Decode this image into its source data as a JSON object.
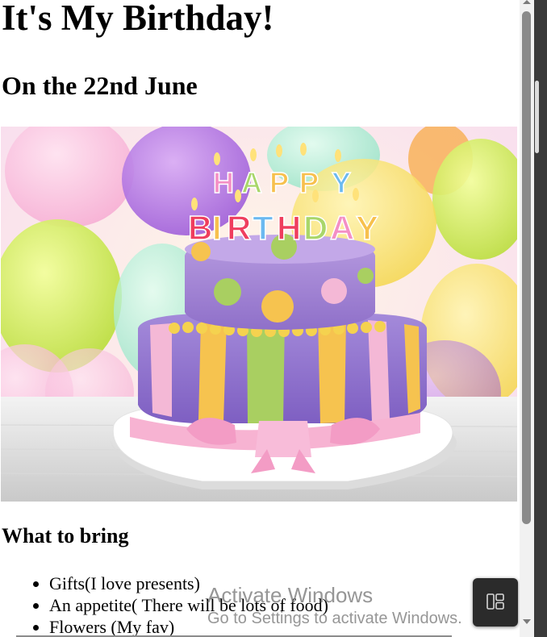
{
  "page": {
    "title": "It's My Birthday!",
    "date_heading": "On the 22nd June",
    "cake_image": {
      "alt_semantic": "birthday-cake-photo",
      "candle_text": "HAPPY BIRTHDAY"
    },
    "bring_heading": "What to bring",
    "bring_items": [
      "Gifts(I love presents)",
      "An appetite( There will be lots of food)",
      "Flowers (My fav)"
    ]
  },
  "watermark": {
    "line1": "Activate Windows",
    "line2": "Go to Settings to activate Windows."
  },
  "floating_button": {
    "icon": "layout-panel-icon"
  },
  "colors": {
    "text": "#000000",
    "background": "#ffffff",
    "scroll_thumb": "#8a8a8a",
    "fab_bg": "#2b2b2b"
  }
}
